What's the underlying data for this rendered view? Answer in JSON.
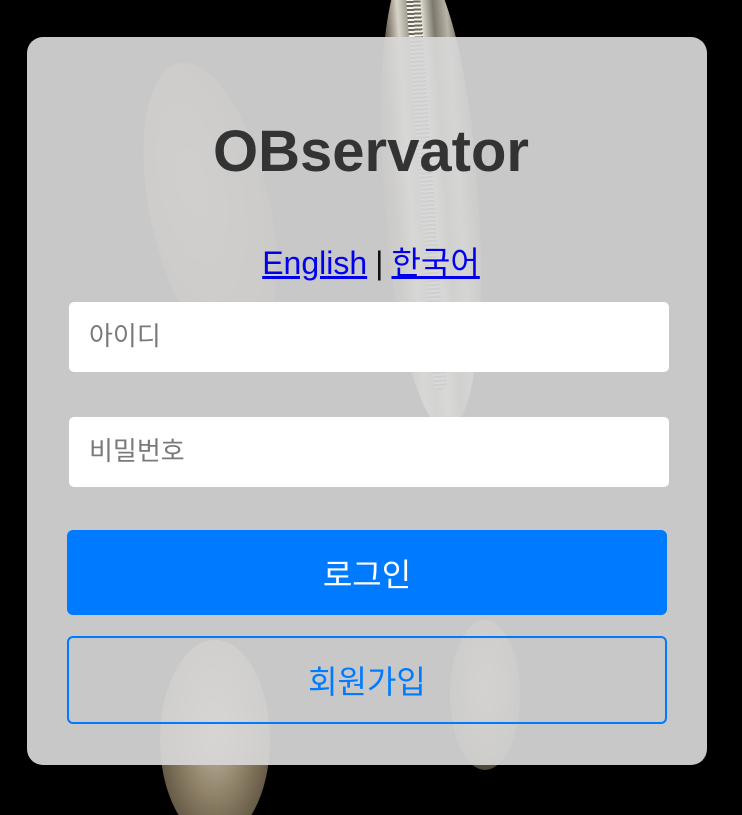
{
  "app": {
    "title": "OBservator"
  },
  "language": {
    "english": "English",
    "separator": "|",
    "korean": "한국어"
  },
  "form": {
    "id_placeholder": "아이디",
    "password_placeholder": "비밀번호",
    "login_label": "로그인",
    "signup_label": "회원가입"
  },
  "colors": {
    "primary": "#007bff",
    "title": "#333333",
    "link": "#0000ee",
    "card_background": "#d7d7d7"
  }
}
